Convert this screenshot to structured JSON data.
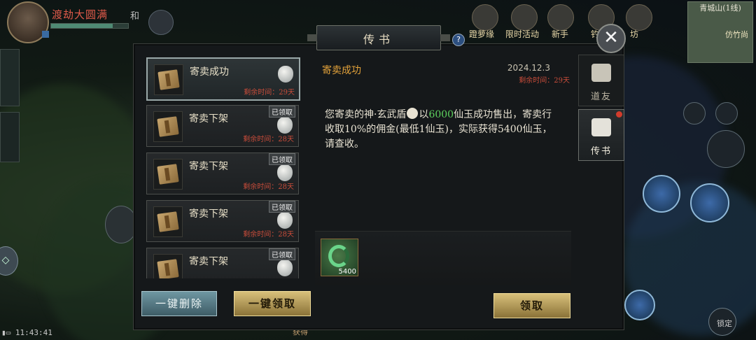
{
  "hud": {
    "player_name": "渡劫大圆满",
    "top_labels": [
      "蹬萝缘",
      "限时活动",
      "新手",
      "钓",
      "坊"
    ],
    "map_name": "青城山(1线)",
    "map_sub": "仿竹尚",
    "time": "11:43:41",
    "chat_text": "获得",
    "lock_label": "锁定",
    "hud_char_he": "和"
  },
  "dialog": {
    "title": "传书",
    "help": "?",
    "close": "✕"
  },
  "mails": [
    {
      "title": "寄卖成功",
      "remain": "剩余时间：29天",
      "claimed": "",
      "selected": true
    },
    {
      "title": "寄卖下架",
      "remain": "剩余时间：28天",
      "claimed": "已领取",
      "selected": false
    },
    {
      "title": "寄卖下架",
      "remain": "剩余时间：28天",
      "claimed": "已领取",
      "selected": false
    },
    {
      "title": "寄卖下架",
      "remain": "剩余时间：28天",
      "claimed": "已领取",
      "selected": false
    },
    {
      "title": "寄卖下架",
      "remain": "",
      "claimed": "已领取",
      "selected": false
    }
  ],
  "content": {
    "title": "寄卖成功",
    "date": "2024.12.3",
    "remain": "剩余时间：29天",
    "body_1": "您寄卖的神·玄武盾",
    "body_2": "以",
    "body_price": "6000",
    "body_3": "仙玉成功售出，寄卖行收取10%的佣金(最低1仙玉)，实际获得5400仙玉，请查收。",
    "attachment_qty": "5400"
  },
  "tabs": [
    {
      "label": "道友",
      "icon": "friend-icon",
      "active": false
    },
    {
      "label": "传书",
      "icon": "mail-chat-icon",
      "active": true
    }
  ],
  "buttons": {
    "delete_all": "一键删除",
    "claim_all": "一键领取",
    "claim": "领取"
  },
  "colors": {
    "remain_red": "#c84c3a",
    "title_orange": "#e3a23a",
    "price_green": "#5ed45e",
    "gold_button": "#d8c07a"
  }
}
